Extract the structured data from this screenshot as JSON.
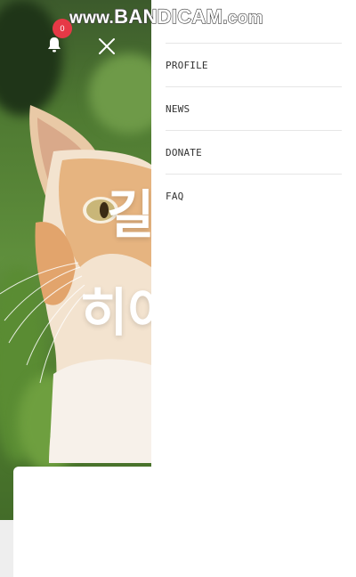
{
  "watermark": {
    "text": "www.BANDICAM.com",
    "prefix": "www.",
    "brand": "BANDICAM",
    "suffix": ".com"
  },
  "header": {
    "notification_count": "0"
  },
  "hero": {
    "line1": "길",
    "line2": "히어"
  },
  "menu": {
    "items": [
      {
        "label": "PROFILE"
      },
      {
        "label": "NEWS"
      },
      {
        "label": "DONATE"
      },
      {
        "label": "FAQ"
      }
    ]
  },
  "colors": {
    "badge": "#e63946",
    "drawer_bg": "#ffffff",
    "divider": "#e6e6e6"
  },
  "icons": {
    "bell": "bell-icon",
    "close": "close-icon"
  }
}
